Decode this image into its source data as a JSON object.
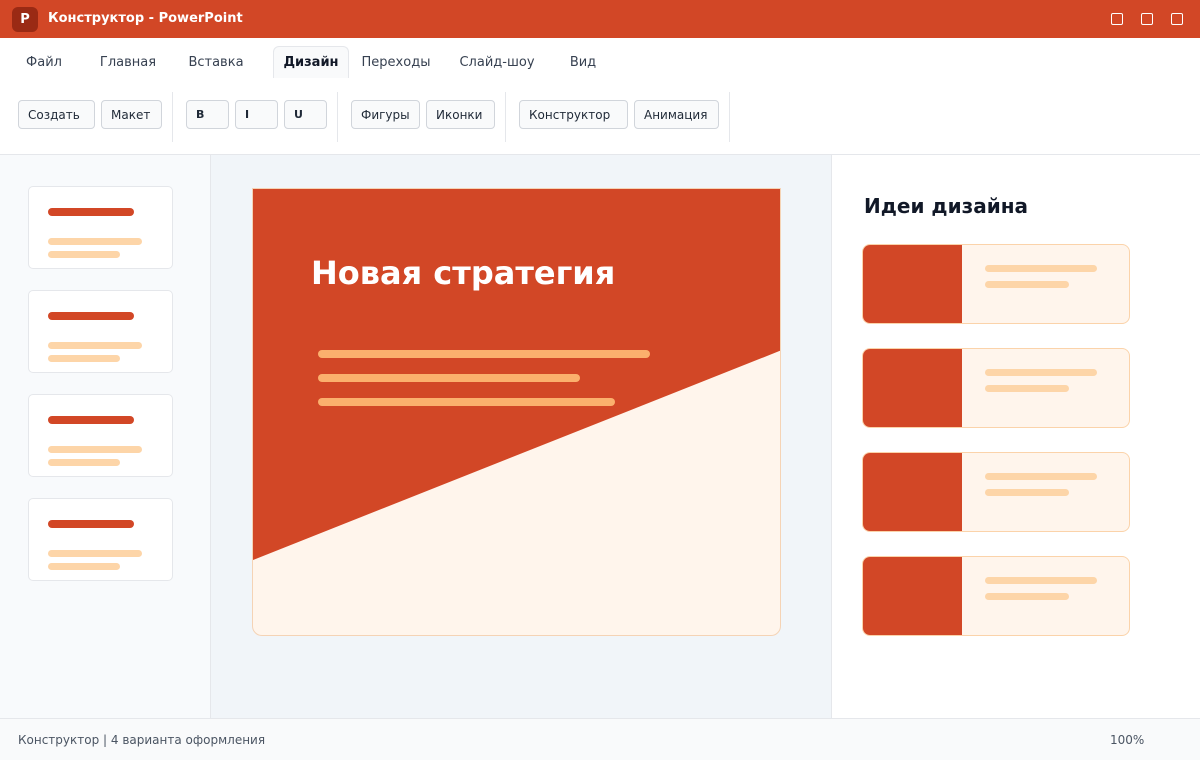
{
  "window": {
    "app_icon_letter": "P",
    "title": "Конструктор - PowerPoint"
  },
  "tabs": [
    {
      "label": "Файл",
      "active": false
    },
    {
      "label": "Главная",
      "active": false
    },
    {
      "label": "Вставка",
      "active": false
    },
    {
      "label": "Дизайн",
      "active": true
    },
    {
      "label": "Переходы",
      "active": false
    },
    {
      "label": "Слайд-шоу",
      "active": false
    },
    {
      "label": "Вид",
      "active": false
    }
  ],
  "ribbon": {
    "create": "Создать",
    "layout": "Макет",
    "bold": "B",
    "italic": "I",
    "underline": "U",
    "shapes": "Фигуры",
    "icons": "Иконки",
    "designer": "Конструктор",
    "animation": "Анимация"
  },
  "slide": {
    "title": "Новая стратегия"
  },
  "thumbnails_count": 4,
  "ideas": {
    "title": "Идеи дизайна",
    "count": 4
  },
  "status": {
    "left": "Конструктор | 4 варианта оформления",
    "zoom": "100%"
  },
  "colors": {
    "accent": "#d24726",
    "cream": "#fff5ec",
    "peach_line": "#fdd5a8",
    "orange_line": "#fbb06d"
  }
}
